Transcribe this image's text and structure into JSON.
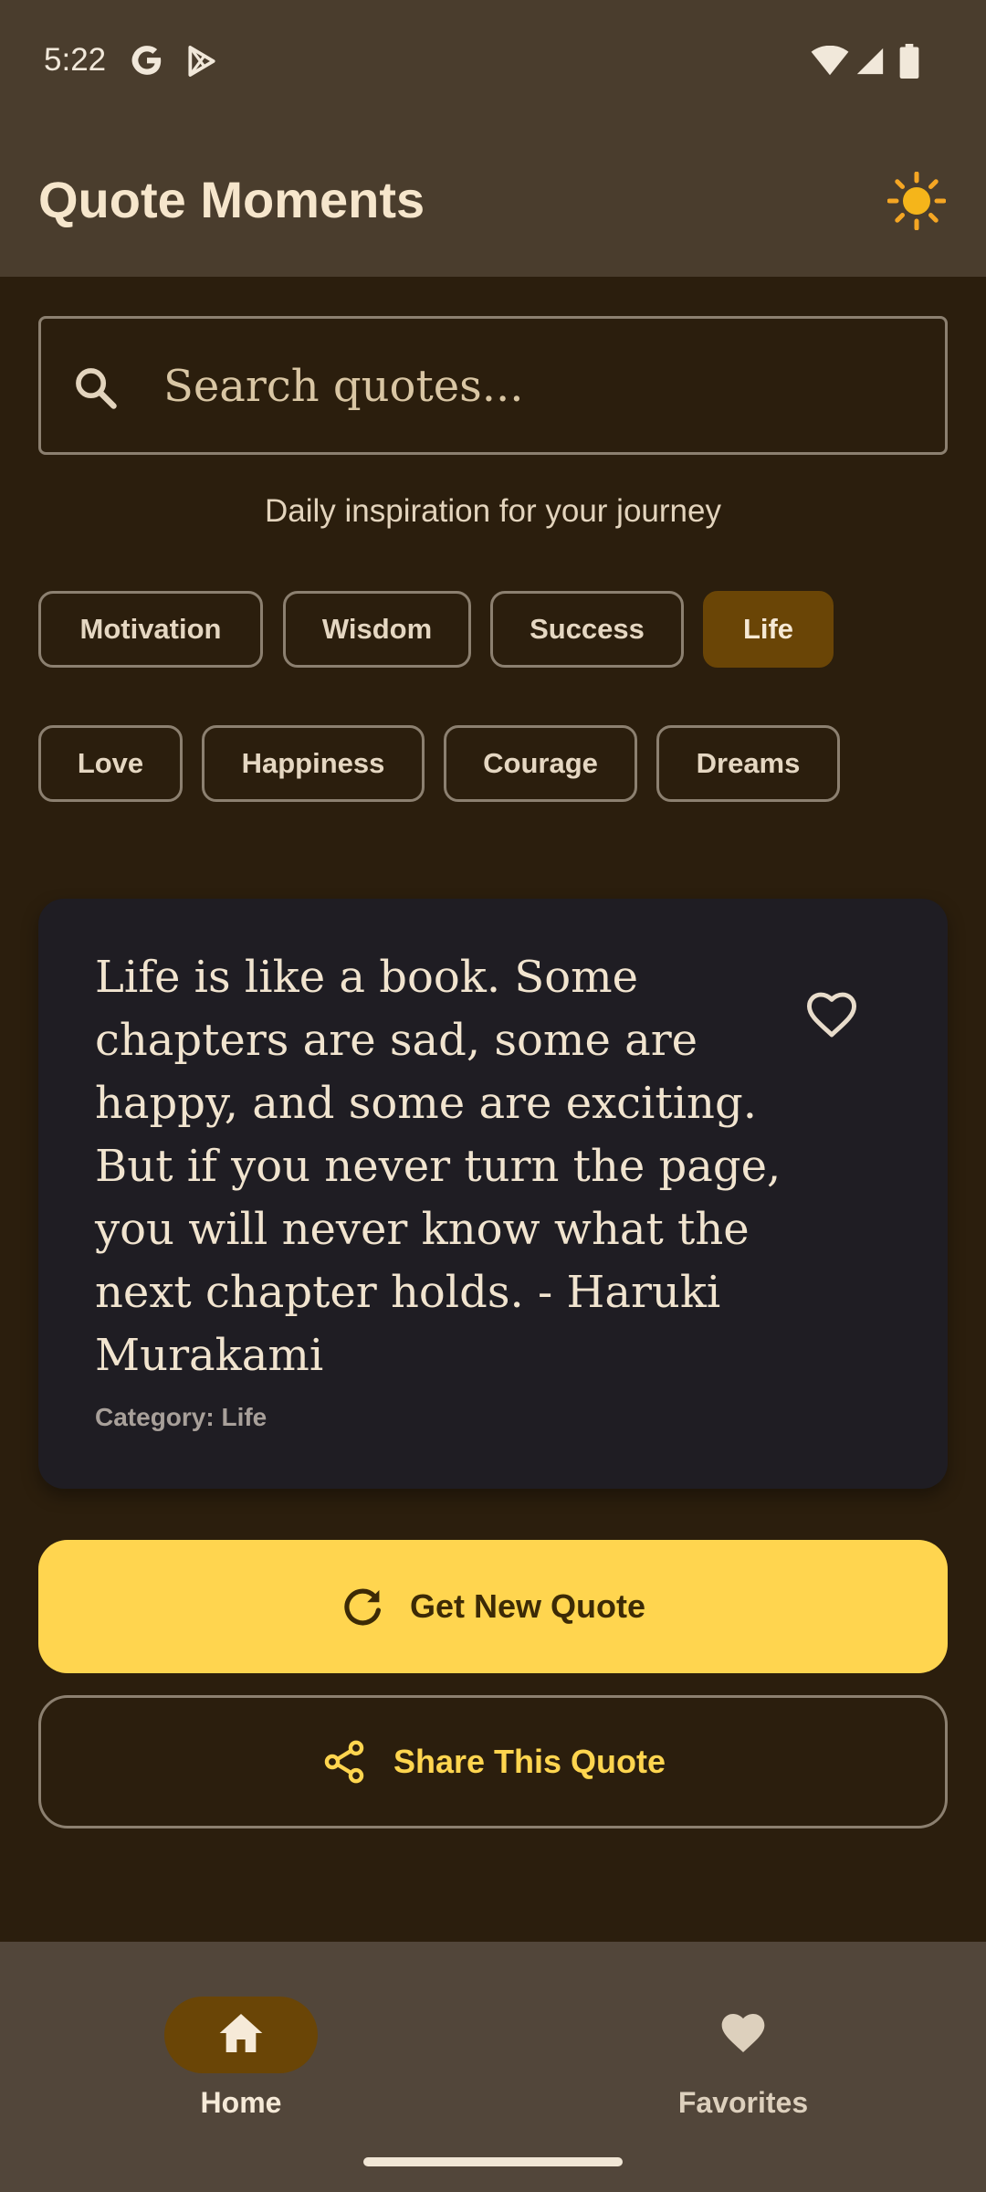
{
  "status_bar": {
    "time": "5:22",
    "icons": [
      "google-icon",
      "play-store-icon",
      "wifi-icon",
      "signal-icon",
      "battery-icon"
    ]
  },
  "app_bar": {
    "title": "Quote Moments",
    "theme_icon": "sun-icon"
  },
  "search": {
    "placeholder": "Search quotes...",
    "value": "",
    "icon": "search-icon"
  },
  "tagline": "Daily inspiration for your journey",
  "categories": [
    {
      "label": "Motivation",
      "selected": false
    },
    {
      "label": "Wisdom",
      "selected": false
    },
    {
      "label": "Success",
      "selected": false
    },
    {
      "label": "Life",
      "selected": true
    },
    {
      "label": "Love",
      "selected": false
    },
    {
      "label": "Happiness",
      "selected": false
    },
    {
      "label": "Courage",
      "selected": false
    },
    {
      "label": "Dreams",
      "selected": false
    }
  ],
  "quote_card": {
    "text": "Life is like a book. Some chapters are sad, some are happy, and some are exciting. But if you never turn the page, you will never know what the next chapter holds. - Haruki Murakami",
    "category": "Category: Life",
    "favorite_icon": "heart-outline-icon"
  },
  "actions": {
    "new_quote_label": "Get New Quote",
    "share_label": "Share This Quote"
  },
  "bottom_nav": {
    "items": [
      {
        "label": "Home",
        "icon": "home-icon",
        "active": true
      },
      {
        "label": "Favorites",
        "icon": "heart-icon",
        "active": false
      }
    ]
  },
  "colors": {
    "background": "#2b1e0d",
    "app_bar": "#4a3d2d",
    "accent": "#ffd54f",
    "chip_selected": "#6a4506",
    "card": "#1f1d23",
    "bottom_nav": "#52463a"
  }
}
